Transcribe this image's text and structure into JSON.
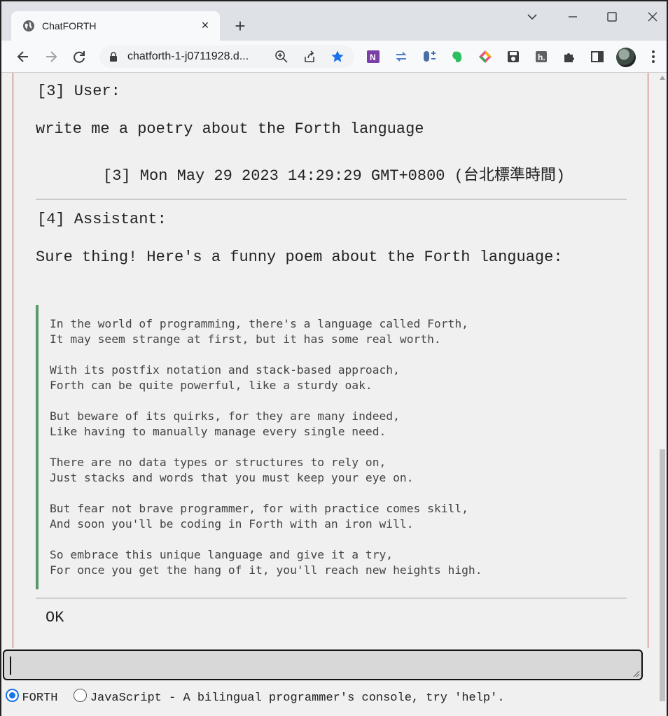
{
  "browser": {
    "tab_title": "ChatFORTH",
    "tab_close": "×",
    "new_tab": "+",
    "url": "chatforth-1-j0711928.d..."
  },
  "icons": {
    "favicon": "globe-icon",
    "back": "back-arrow-icon",
    "forward": "forward-arrow-icon",
    "reload": "reload-icon",
    "lock": "site-info-icon",
    "zoom": "zoom-icon",
    "share": "share-icon",
    "bookmark": "star-icon",
    "extensions": [
      "onenote-icon",
      "sync-icon",
      "mouse-icon",
      "evernote-icon",
      "diamond-icon",
      "save-icon",
      "h-icon",
      "puzzle-icon",
      "sidepanel-icon"
    ],
    "menu": "kebab-menu-icon"
  },
  "colors": {
    "bookmark_star": "#1a73e8",
    "poem_border": "#5a9a6a",
    "console_border": "#bb5555",
    "radio_accent": "#1a73e8"
  },
  "conversation": {
    "user_header": "[3] User:",
    "user_message": "write me a poetry about the Forth language",
    "timestamp": "[3] Mon May 29 2023 14:29:29 GMT+0800 (台北標準時間)",
    "assistant_header": "[4] Assistant:",
    "assistant_intro": "Sure thing! Here's a funny poem about the Forth language:",
    "poem": [
      "In the world of programming, there's a language called Forth,\nIt may seem strange at first, but it has some real worth.",
      "With its postfix notation and stack-based approach,\nForth can be quite powerful, like a sturdy oak.",
      "But beware of its quirks, for they are many indeed,\nLike having to manually manage every single need.",
      "There are no data types or structures to rely on,\nJust stacks and words that you must keep your eye on.",
      "But fear not brave programmer, for with practice comes skill,\nAnd soon you'll be coding in Forth with an iron will.",
      "So embrace this unique language and give it a try,\nFor once you get the hang of it, you'll reach new heights high."
    ],
    "status": "OK"
  },
  "console": {
    "input_value": "",
    "mode_forth": "FORTH",
    "mode_js": "JavaScript - A bilingual programmer's console, try 'help'.",
    "selected_mode": "FORTH"
  }
}
